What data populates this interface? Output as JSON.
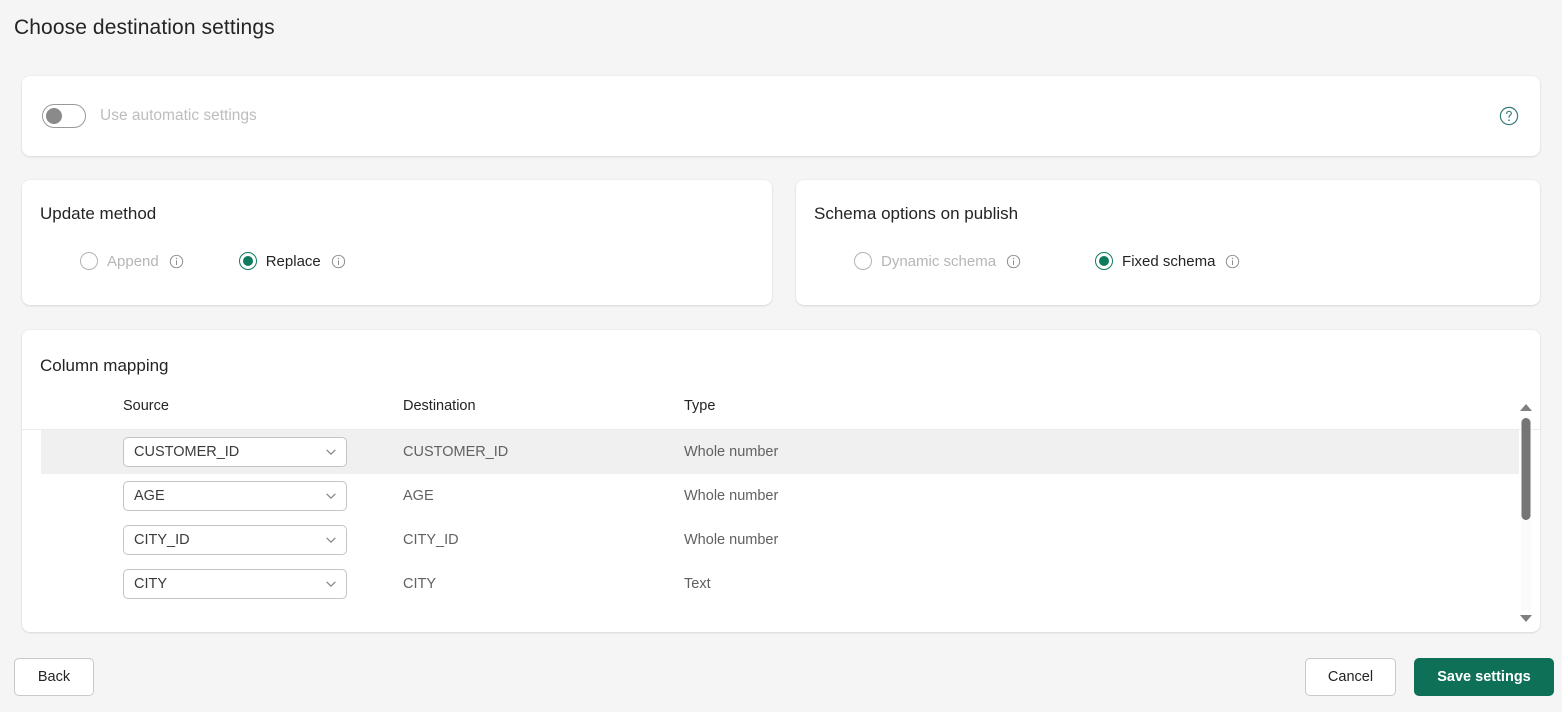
{
  "page": {
    "title": "Choose destination settings"
  },
  "auto_settings": {
    "toggle_label": "Use automatic settings",
    "toggle_on": false,
    "help_icon": "question-circle-icon"
  },
  "update_method": {
    "heading": "Update method",
    "options": [
      {
        "label": "Append",
        "selected": false,
        "info_icon": "info-icon"
      },
      {
        "label": "Replace",
        "selected": true,
        "info_icon": "info-icon"
      }
    ]
  },
  "schema_options": {
    "heading": "Schema options on publish",
    "options": [
      {
        "label": "Dynamic schema",
        "selected": false,
        "info_icon": "info-icon"
      },
      {
        "label": "Fixed schema",
        "selected": true,
        "info_icon": "info-icon"
      }
    ]
  },
  "column_mapping": {
    "heading": "Column mapping",
    "columns": [
      "Source",
      "Destination",
      "Type"
    ],
    "rows": [
      {
        "source": "CUSTOMER_ID",
        "destination": "CUSTOMER_ID",
        "type": "Whole number",
        "highlighted": true
      },
      {
        "source": "AGE",
        "destination": "AGE",
        "type": "Whole number",
        "highlighted": false
      },
      {
        "source": "CITY_ID",
        "destination": "CITY_ID",
        "type": "Whole number",
        "highlighted": false
      },
      {
        "source": "CITY",
        "destination": "CITY",
        "type": "Text",
        "highlighted": false
      }
    ],
    "scrollbar": {
      "up_icon": "triangle-up-icon",
      "down_icon": "triangle-down-icon"
    }
  },
  "footer": {
    "back_label": "Back",
    "cancel_label": "Cancel",
    "save_label": "Save settings"
  },
  "colors": {
    "accent_green": "#0f7058",
    "radio_green": "#0f7b5e",
    "help_teal": "#3a7d7d",
    "page_background": "#f5f5f5",
    "card_background": "#ffffff",
    "row_highlight": "#f0f0f0",
    "muted_text": "#b6b6b6"
  }
}
